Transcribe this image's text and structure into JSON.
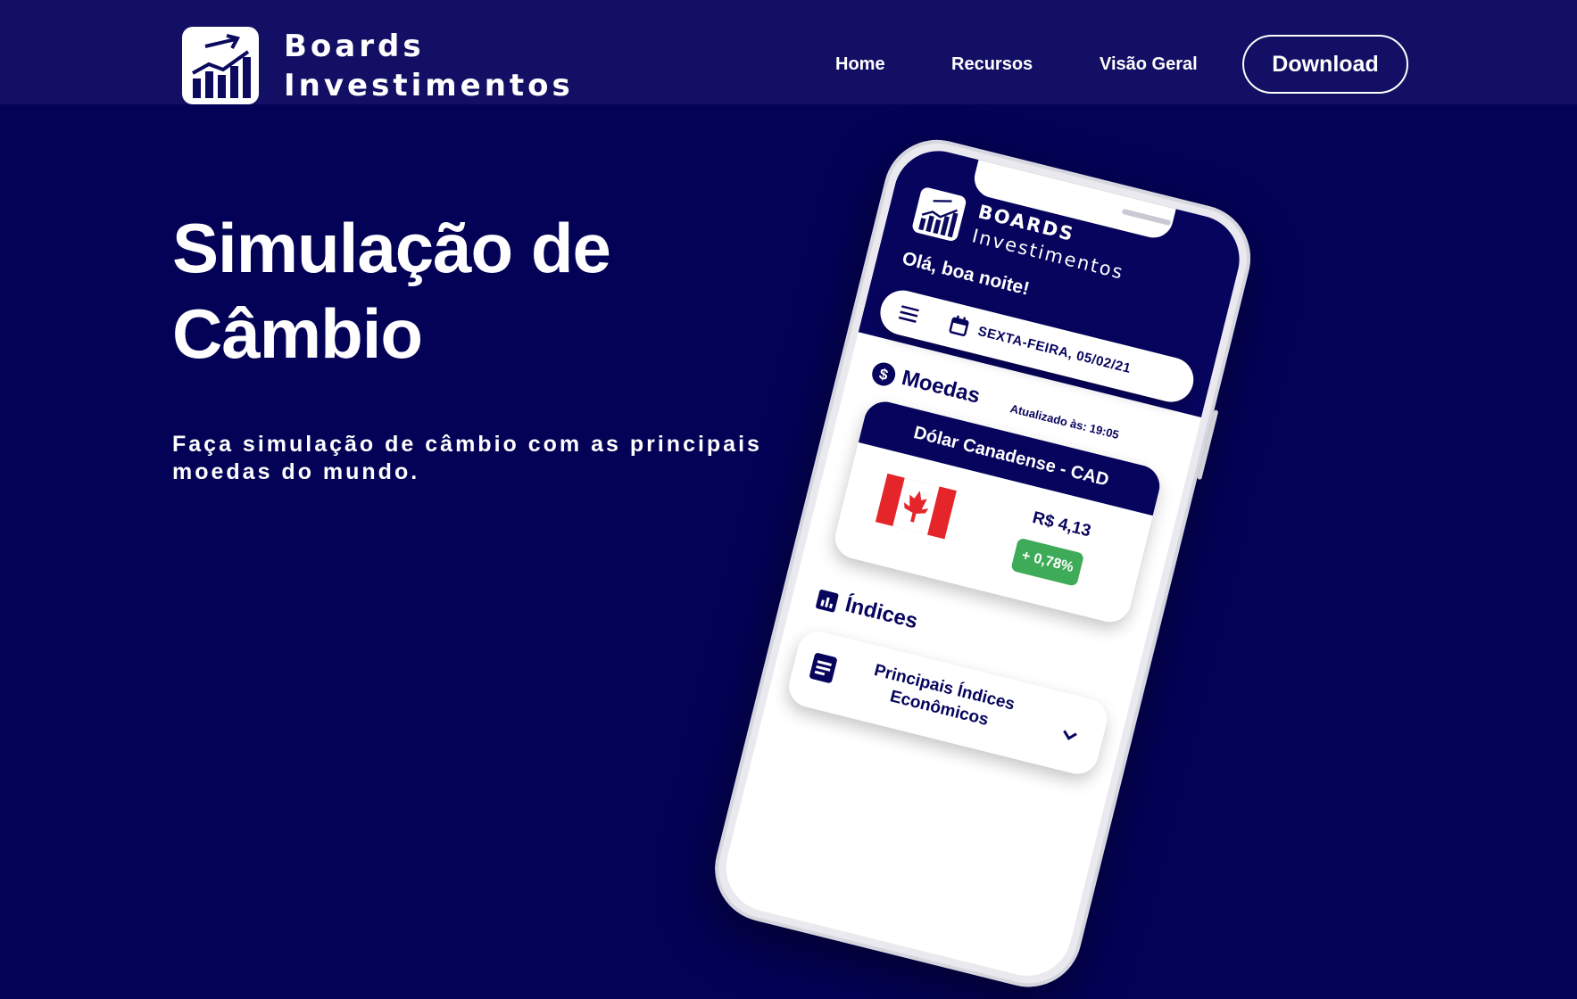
{
  "header": {
    "brand_line1": "Boards",
    "brand_line2": "Investimentos",
    "nav": {
      "home": "Home",
      "recursos": "Recursos",
      "visao_geral": "Visão Geral"
    },
    "download_label": "Download"
  },
  "hero": {
    "title_line1": "Simulação de",
    "title_line2": "Câmbio",
    "subtitle": "Faça simulação de câmbio com as principais moedas do mundo."
  },
  "phone_app": {
    "brand_line1": "BOARDS",
    "brand_line2": "Investimentos",
    "greeting": "Olá, boa noite!",
    "date": "SEXTA-FEIRA, 05/02/21",
    "moedas_title": "Moedas",
    "updated_at": "Atualizado às: 19:05",
    "currency": {
      "name": "Dólar Canadense - CAD",
      "price": "R$ 4,13",
      "change": "+ 0,78%",
      "change_color": "#3dab57"
    },
    "indices_title": "Índices",
    "indices_card": "Principais Índices Econômicos"
  },
  "colors": {
    "background": "#030257",
    "navbar": "#120f64",
    "accent": "#06045c"
  },
  "icons": [
    "logo-chart-icon",
    "menu-icon",
    "calendar-icon",
    "dollar-icon",
    "canada-flag-icon",
    "bar-chart-icon",
    "document-icon",
    "chevron-down-icon"
  ]
}
